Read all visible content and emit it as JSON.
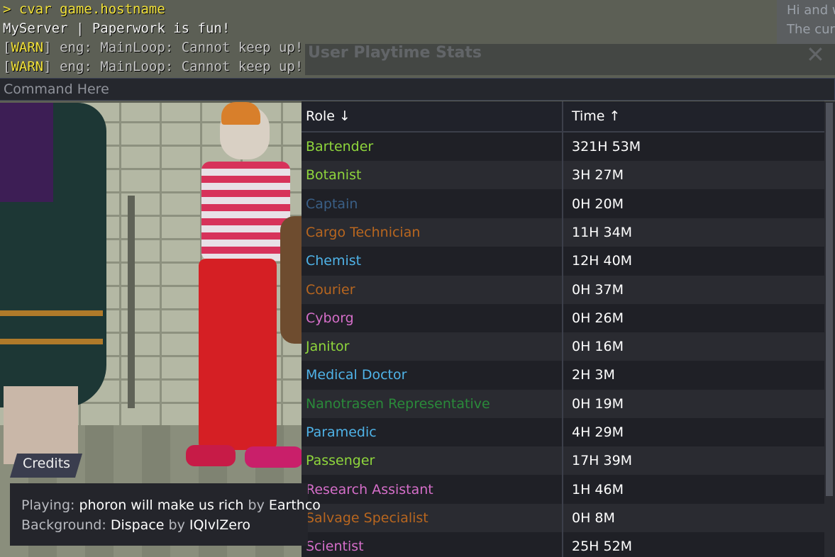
{
  "console": {
    "lines": [
      {
        "prompt": ">",
        "text": " cvar game.hostname"
      },
      {
        "text": "MyServer | Paperwork is fun!"
      },
      {
        "tag_open": "[",
        "tag": "WARN",
        "tag_close": "]",
        "text": " eng: MainLoop: Cannot keep up!"
      },
      {
        "tag_open": "[",
        "tag": "WARN",
        "tag_close": "]",
        "text": " eng: MainLoop: Cannot keep up!"
      }
    ],
    "input_placeholder": "Command Here"
  },
  "chat": {
    "lines": [
      "Hi and w",
      "The cur"
    ]
  },
  "window": {
    "title": "User Playtime Stats",
    "close_glyph": "✕"
  },
  "table": {
    "headers": {
      "role": "Role ↓",
      "time": "Time ↑"
    },
    "rows": [
      {
        "role": "Bartender",
        "time": "321H 53M",
        "color": "#8fd63c"
      },
      {
        "role": "Botanist",
        "time": "3H 27M",
        "color": "#8fd63c"
      },
      {
        "role": "Captain",
        "time": "0H 20M",
        "color": "#3a5f86"
      },
      {
        "role": "Cargo Technician",
        "time": "11H 34M",
        "color": "#b8661f"
      },
      {
        "role": "Chemist",
        "time": "12H 40M",
        "color": "#4fb3e8"
      },
      {
        "role": "Courier",
        "time": "0H 37M",
        "color": "#b8661f"
      },
      {
        "role": "Cyborg",
        "time": "0H 26M",
        "color": "#d56ec9"
      },
      {
        "role": "Janitor",
        "time": "0H 16M",
        "color": "#8fd63c"
      },
      {
        "role": "Medical Doctor",
        "time": "2H 3M",
        "color": "#4fb3e8"
      },
      {
        "role": "Nanotrasen Representative",
        "time": "0H 19M",
        "color": "#2a8a3a"
      },
      {
        "role": "Paramedic",
        "time": "4H 29M",
        "color": "#4fb3e8"
      },
      {
        "role": "Passenger",
        "time": "17H 39M",
        "color": "#8fd63c"
      },
      {
        "role": "Research Assistant",
        "time": "1H 46M",
        "color": "#d56ec9"
      },
      {
        "role": "Salvage Specialist",
        "time": "0H 8M",
        "color": "#b8661f"
      },
      {
        "role": "Scientist",
        "time": "25H 52M",
        "color": "#d56ec9"
      }
    ]
  },
  "credits": {
    "tab_label": "Credits",
    "playing_label": "Playing:",
    "playing_title": "phoron will make us rich",
    "playing_by": "by",
    "playing_artist": "Earthco",
    "background_label": "Background:",
    "background_title": "Dispace",
    "background_by": "by",
    "background_artist": "IQlvlZero"
  },
  "colors": {
    "console_yellow": "#f2e23a",
    "panel_bg": "#1f2026",
    "alt_row_bg": "#2a2b31"
  }
}
